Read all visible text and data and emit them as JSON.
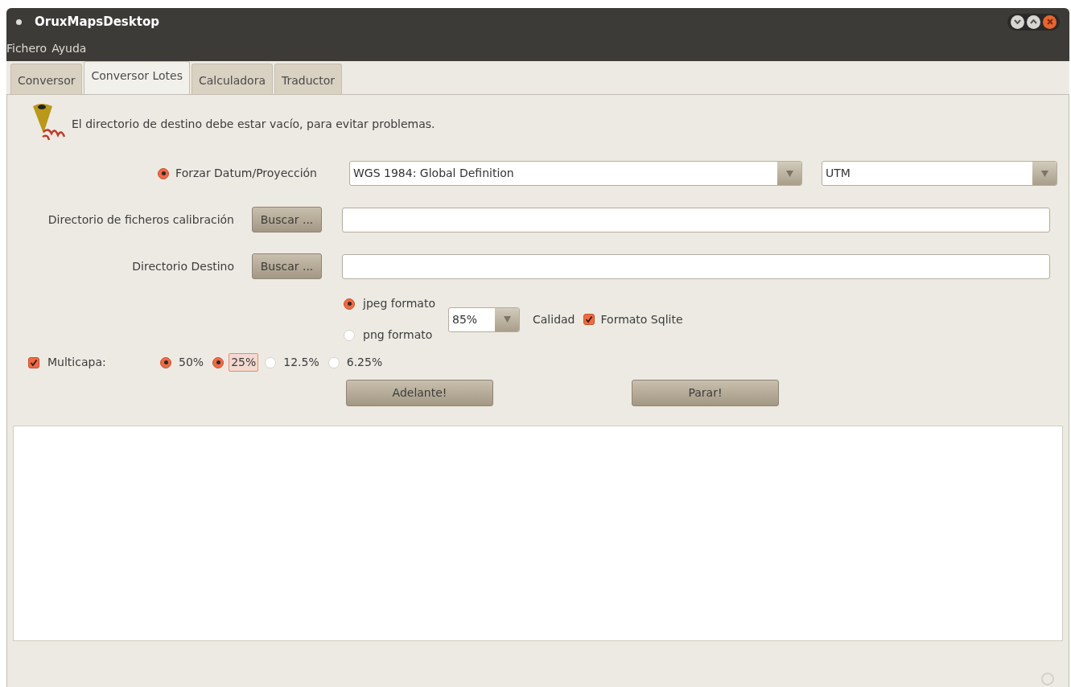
{
  "window": {
    "title": "OruxMapsDesktop"
  },
  "menu": [
    "Fichero",
    "Ayuda"
  ],
  "tabs": [
    {
      "label": "Conversor",
      "selected": false
    },
    {
      "label": "Conversor Lotes",
      "selected": true
    },
    {
      "label": "Calculadora",
      "selected": false
    },
    {
      "label": "Traductor",
      "selected": false
    }
  ],
  "notice": "El directorio de destino debe estar vacío, para evitar problemas.",
  "datum": {
    "label": "Forzar Datum/Proyección",
    "selected": true,
    "datum_value": "WGS 1984: Global Definition",
    "projection_value": "UTM"
  },
  "directories": [
    {
      "label": "Directorio de ficheros calibración",
      "button": "Buscar ..."
    },
    {
      "label": "Directorio Destino",
      "button": "Buscar ..."
    }
  ],
  "formats": [
    {
      "label": "jpeg formato",
      "selected": true
    },
    {
      "label": "png formato",
      "selected": false
    }
  ],
  "quality": {
    "value": "85%",
    "label": "Calidad"
  },
  "sqlite": {
    "label": "Formato Sqlite",
    "checked": true
  },
  "multilayer": {
    "label": "Multicapa:",
    "checked": true,
    "levels": [
      {
        "label": "50%",
        "selected": true,
        "focused": false
      },
      {
        "label": "25%",
        "selected": true,
        "focused": true
      },
      {
        "label": "12.5%",
        "selected": false,
        "focused": false
      },
      {
        "label": "6.25%",
        "selected": false,
        "focused": false
      }
    ]
  },
  "buttons": [
    "Adelante!",
    "Parar!"
  ]
}
